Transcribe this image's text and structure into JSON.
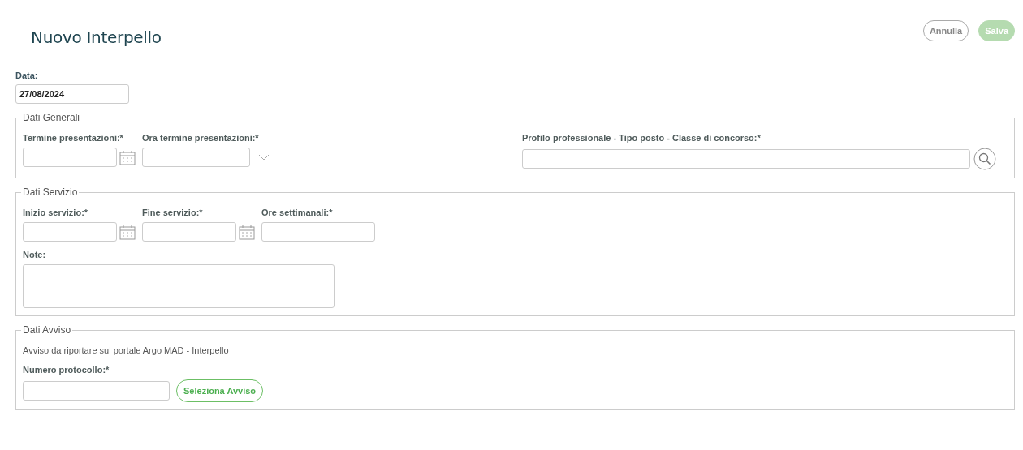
{
  "header": {
    "title": "Nuovo Interpello",
    "buttons": [
      {
        "label": "Annulla",
        "kind": "cancel",
        "disabled": false
      },
      {
        "label": "Salva",
        "kind": "save",
        "disabled": true
      }
    ]
  },
  "date_field": {
    "label": "Data:",
    "value": "27/08/2024"
  },
  "sections": [
    {
      "legend": "Dati Generali",
      "rows": [
        [
          {
            "label": "Termine presentazioni:*",
            "kind": "date"
          },
          {
            "label": "Ora termine presentazioni:*",
            "kind": "time"
          },
          {
            "label": "Profilo professionale - Tipo posto - Classe di concorso:*",
            "kind": "lookup"
          }
        ]
      ]
    },
    {
      "legend": "Dati Servizio",
      "rows": [
        [
          {
            "label": "Inizio servizio:*",
            "kind": "date"
          },
          {
            "label": "Fine servizio:*",
            "kind": "date"
          },
          {
            "label": "Ore settimanali:*",
            "kind": "text"
          }
        ],
        [
          {
            "label": "Note:",
            "kind": "textarea"
          }
        ]
      ]
    },
    {
      "legend": "Dati Avviso",
      "note": "Avviso da riportare sul portale Argo MAD - Interpello",
      "rows": [
        [
          {
            "label": "Numero protocollo:*",
            "kind": "text",
            "action": "Seleziona Avviso"
          }
        ]
      ]
    }
  ]
}
